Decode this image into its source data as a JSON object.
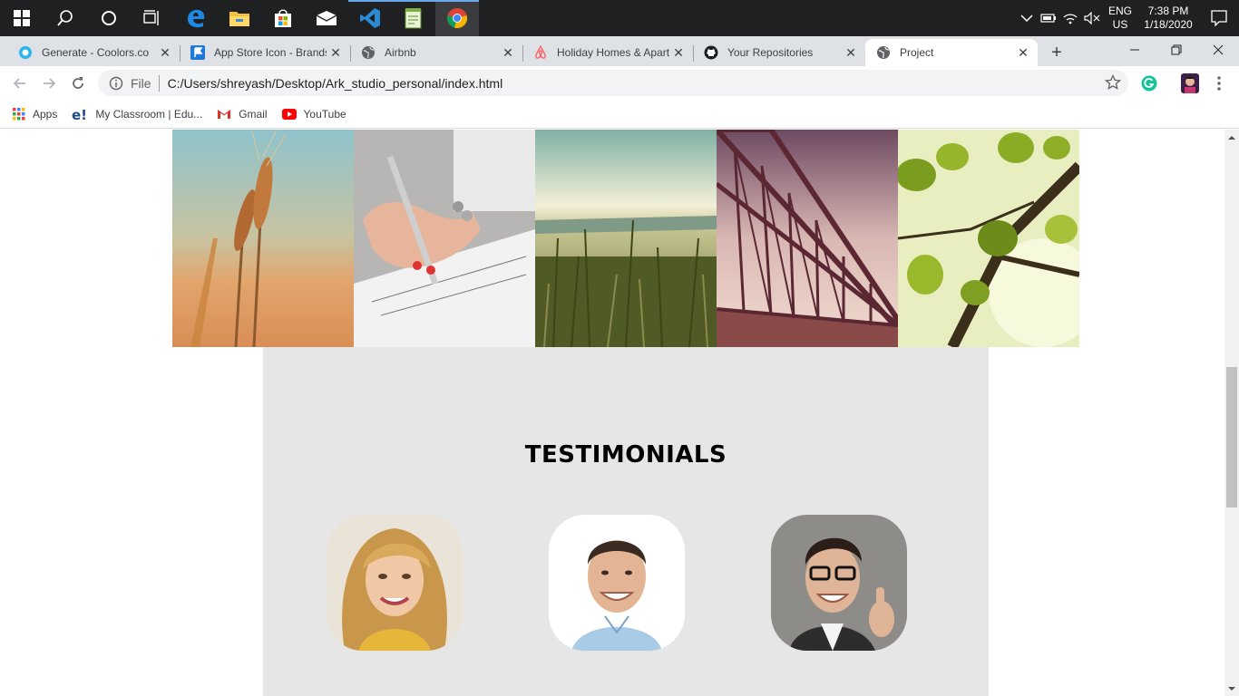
{
  "taskbar": {
    "apps": [
      "start",
      "search",
      "cortana",
      "task-view",
      "edge",
      "file-explorer",
      "store",
      "mail",
      "vscode",
      "notepad",
      "chrome"
    ],
    "language_line1": "ENG",
    "language_line2": "US",
    "time": "7:38 PM",
    "date": "1/18/2020"
  },
  "tabs": [
    {
      "title": "Generate - Coolors.co",
      "icon": "coolors-icon"
    },
    {
      "title": "App Store Icon - Brands",
      "icon": "flag-icon"
    },
    {
      "title": "Airbnb",
      "icon": "globe-icon"
    },
    {
      "title": "Holiday Homes & Apartments",
      "icon": "airbnb-icon"
    },
    {
      "title": "Your Repositories",
      "icon": "github-icon"
    },
    {
      "title": "Project",
      "icon": "globe-icon"
    }
  ],
  "omnibox": {
    "scheme_label": "File",
    "url": "C:/Users/shreyash/Desktop/Ark_studio_personal/index.html"
  },
  "bookmarks": [
    {
      "label": "Apps",
      "icon": "apps-grid-icon"
    },
    {
      "label": "My Classroom | Edu...",
      "icon": "edureka-icon"
    },
    {
      "label": "Gmail",
      "icon": "gmail-icon"
    },
    {
      "label": "YouTube",
      "icon": "youtube-icon"
    }
  ],
  "page": {
    "gallery": [
      "wheat-photo",
      "writing-photo",
      "field-photo",
      "bridge-photo",
      "leaves-photo"
    ],
    "testimonials_title": "TESTIMONIALS",
    "avatars": [
      "woman-avatar",
      "smiling-man-avatar",
      "glasses-man-avatar"
    ]
  },
  "colors": {
    "taskbar_bg": "#1f2022",
    "tabstrip_bg": "#dee1e6",
    "testimonials_bg": "#e6e6e6"
  }
}
